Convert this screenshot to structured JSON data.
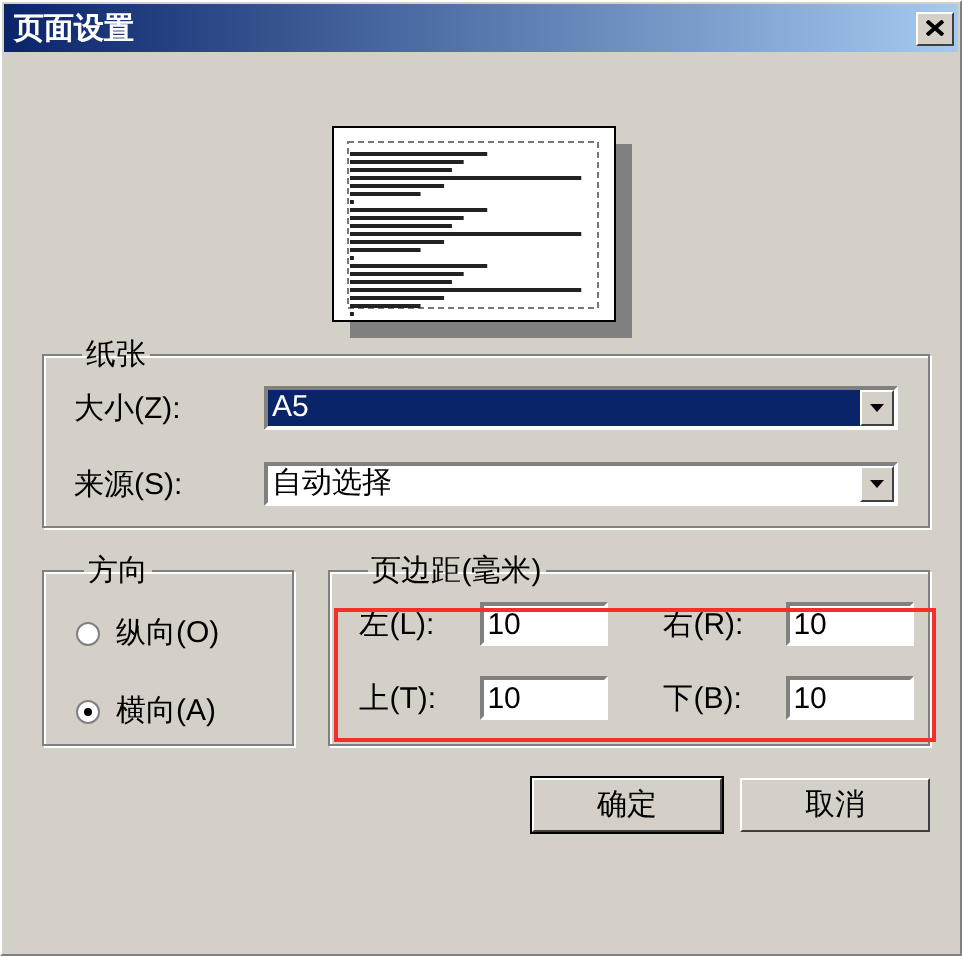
{
  "window": {
    "title": "页面设置"
  },
  "paper": {
    "title": "纸张",
    "fields": [
      {
        "label": "大小(Z):",
        "value": "A5",
        "selected": true
      },
      {
        "label": "来源(S):",
        "value": "自动选择",
        "selected": false
      }
    ]
  },
  "orientation": {
    "title": "方向",
    "options": [
      {
        "label": "纵向(O)",
        "selected": false
      },
      {
        "label": "横向(A)",
        "selected": true
      }
    ]
  },
  "margins": {
    "title": "页边距(毫米)",
    "highlighted": true,
    "fields": [
      {
        "label": "左(L):",
        "value": "10"
      },
      {
        "label": "右(R):",
        "value": "10"
      },
      {
        "label": "上(T):",
        "value": "10"
      },
      {
        "label": "下(B):",
        "value": "10"
      }
    ]
  },
  "buttons": [
    {
      "label": "确定",
      "default": true
    },
    {
      "label": "取消",
      "default": false
    }
  ]
}
